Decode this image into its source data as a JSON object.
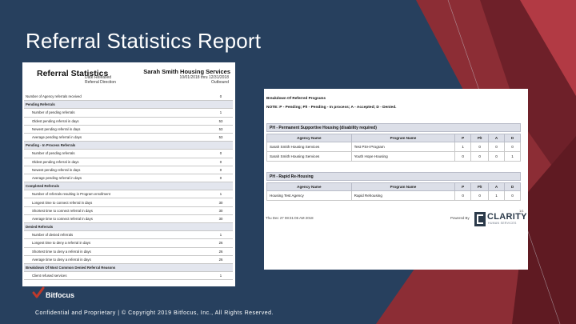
{
  "slide": {
    "title": "Referral Statistics Report",
    "copyright": "Confidential and Proprietary | © Copyright 2019 Bitfocus, Inc., All Rights Reserved.",
    "brand_logo_text": "Bitfocus"
  },
  "left_report": {
    "title": "Referral Statistics",
    "fields": [
      "Date Released",
      "Referral Direction"
    ],
    "org_name": "Sarah Smith Housing Services",
    "field_values": [
      "10/01/2018 thru 12/31/2018",
      "Outbound"
    ],
    "rows": [
      {
        "label": "Number of Agency referrals received",
        "value": "0",
        "kind": "top"
      },
      {
        "label": "Pending Referrals",
        "value": "",
        "kind": "section"
      },
      {
        "label": "Number of pending referrals",
        "value": "1",
        "kind": "sub"
      },
      {
        "label": "Oldest pending referral in days",
        "value": "53",
        "kind": "sub"
      },
      {
        "label": "Newest pending referral in days",
        "value": "53",
        "kind": "sub"
      },
      {
        "label": "Average pending referral in days",
        "value": "53",
        "kind": "sub"
      },
      {
        "label": "Pending - In Process Referrals",
        "value": "",
        "kind": "section"
      },
      {
        "label": "Number of pending referrals",
        "value": "0",
        "kind": "sub"
      },
      {
        "label": "Oldest pending referral in days",
        "value": "0",
        "kind": "sub"
      },
      {
        "label": "Newest pending referral in days",
        "value": "0",
        "kind": "sub"
      },
      {
        "label": "Average pending referral in days",
        "value": "0",
        "kind": "sub"
      },
      {
        "label": "Completed Referrals",
        "value": "",
        "kind": "section"
      },
      {
        "label": "Number of referrals resulting in Program enrollment",
        "value": "1",
        "kind": "sub"
      },
      {
        "label": "Longest time to connect referral in days",
        "value": "30",
        "kind": "sub"
      },
      {
        "label": "Shortest time to connect referral in days",
        "value": "30",
        "kind": "sub"
      },
      {
        "label": "Average time to connect referral in days",
        "value": "30",
        "kind": "sub"
      },
      {
        "label": "Denied Referrals",
        "value": "",
        "kind": "section"
      },
      {
        "label": "Number of denied referrals",
        "value": "1",
        "kind": "sub"
      },
      {
        "label": "Longest time to deny a referral in days",
        "value": "26",
        "kind": "sub"
      },
      {
        "label": "Shortest time to deny a referral in days",
        "value": "26",
        "kind": "sub"
      },
      {
        "label": "Average time to deny a referral in days",
        "value": "26",
        "kind": "sub"
      },
      {
        "label": "Breakdown Of Most Common Denied Referral Reasons",
        "value": "",
        "kind": "section"
      },
      {
        "label": "Client refused services",
        "value": "1",
        "kind": "sub"
      }
    ]
  },
  "right_report": {
    "title": "Breakdown Of Referred Programs",
    "note": "NOTE: P - Pending; P/I - Pending - In process; A - Accepted; D - Denied.",
    "sections": [
      {
        "name": "PH - Permanent Supportive Housing (disability required)",
        "headers": [
          "Agency Name",
          "Program Name",
          "P",
          "P/I",
          "A",
          "D"
        ],
        "rows": [
          [
            "Sarah Smith Housing Services",
            "Test PSH Program",
            "1",
            "0",
            "0",
            "0"
          ],
          [
            "Sarah Smith Housing Services",
            "Youth Hope Housing",
            "0",
            "0",
            "0",
            "1"
          ]
        ]
      },
      {
        "name": "PH - Rapid Re-Housing",
        "headers": [
          "Agency Name",
          "Program Name",
          "P",
          "P/I",
          "A",
          "D"
        ],
        "rows": [
          [
            "Housing Test Agency",
            "Rapid Rehousing",
            "0",
            "0",
            "1",
            "0"
          ]
        ]
      }
    ],
    "printed_at": "Thu Dec 27 08:31:06 AM 2018",
    "powered_by": "Powered By",
    "clarity_logo": "CLARITY",
    "clarity_sub": "HUMAN SERVICES",
    "page_number": "1/1"
  }
}
